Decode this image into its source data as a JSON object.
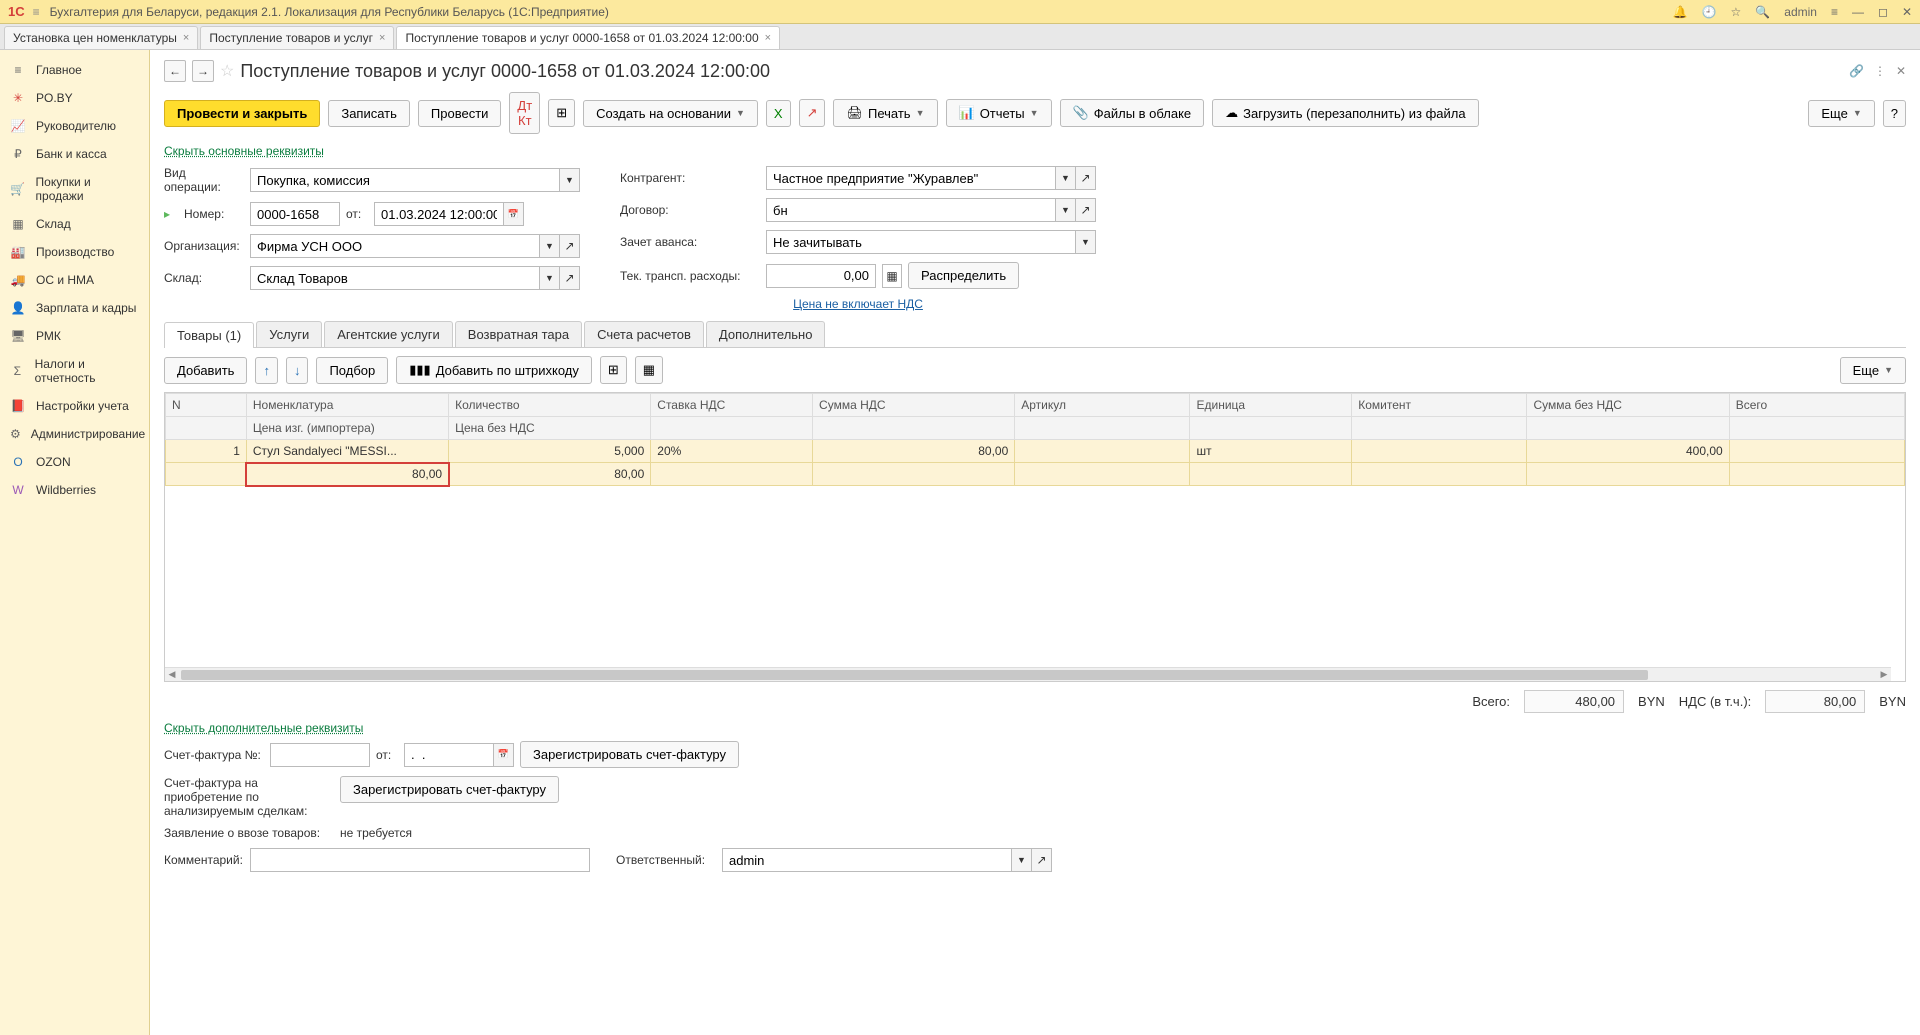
{
  "topbar": {
    "logo": "1C",
    "title": "Бухгалтерия для Беларуси, редакция 2.1. Локализация для Республики Беларусь   (1С:Предприятие)",
    "user": "admin"
  },
  "tabs": [
    {
      "label": "Установка цен номенклатуры",
      "active": false
    },
    {
      "label": "Поступление товаров и услуг",
      "active": false
    },
    {
      "label": "Поступление товаров и услуг 0000-1658 от 01.03.2024 12:00:00",
      "active": true
    }
  ],
  "sidebar": [
    {
      "icon": "≡",
      "label": "Главное",
      "cls": ""
    },
    {
      "icon": "✳",
      "label": "PO.BY",
      "cls": "red"
    },
    {
      "icon": "📈",
      "label": "Руководителю",
      "cls": ""
    },
    {
      "icon": "₽",
      "label": "Банк и касса",
      "cls": ""
    },
    {
      "icon": "🛒",
      "label": "Покупки и продажи",
      "cls": ""
    },
    {
      "icon": "▦",
      "label": "Склад",
      "cls": ""
    },
    {
      "icon": "🏭",
      "label": "Производство",
      "cls": ""
    },
    {
      "icon": "🚚",
      "label": "ОС и НМА",
      "cls": ""
    },
    {
      "icon": "👤",
      "label": "Зарплата и кадры",
      "cls": ""
    },
    {
      "icon": "🖥",
      "label": "РМК",
      "cls": ""
    },
    {
      "icon": "Σ",
      "label": "Налоги и отчетность",
      "cls": ""
    },
    {
      "icon": "📕",
      "label": "Настройки учета",
      "cls": ""
    },
    {
      "icon": "⚙",
      "label": "Администрирование",
      "cls": ""
    },
    {
      "icon": "O",
      "label": "OZON",
      "cls": "blue"
    },
    {
      "icon": "W",
      "label": "Wildberries",
      "cls": "purple"
    }
  ],
  "doc": {
    "title": "Поступление товаров и услуг 0000-1658 от 01.03.2024 12:00:00",
    "hide_main": "Скрыть основные реквизиты",
    "hide_extra": "Скрыть дополнительные реквизиты",
    "vat_link": "Цена не включает НДС"
  },
  "toolbar": {
    "post_close": "Провести и закрыть",
    "write": "Записать",
    "post": "Провести",
    "create_based": "Создать на основании",
    "print": "Печать",
    "reports": "Отчеты",
    "files": "Файлы в облаке",
    "load_file": "Загрузить (перезаполнить) из файла",
    "more": "Еще"
  },
  "fields": {
    "op_type_label": "Вид операции:",
    "op_type": "Покупка, комиссия",
    "number_label": "Номер:",
    "number": "0000-1658",
    "from_label": "от:",
    "date": "01.03.2024 12:00:00",
    "org_label": "Организация:",
    "org": "Фирма УСН ООО",
    "warehouse_label": "Склад:",
    "warehouse": "Склад Товаров",
    "counterparty_label": "Контрагент:",
    "counterparty": "Частное предприятие \"Журавлев\"",
    "contract_label": "Договор:",
    "contract": "бн",
    "advance_label": "Зачет аванса:",
    "advance": "Не зачитывать",
    "transport_label": "Тек. трансп. расходы:",
    "transport": "0,00",
    "distribute": "Распределить"
  },
  "subtabs": [
    {
      "label": "Товары (1)",
      "active": true
    },
    {
      "label": "Услуги",
      "active": false
    },
    {
      "label": "Агентские услуги",
      "active": false
    },
    {
      "label": "Возвратная тара",
      "active": false
    },
    {
      "label": "Счета расчетов",
      "active": false
    },
    {
      "label": "Дополнительно",
      "active": false
    }
  ],
  "table_toolbar": {
    "add": "Добавить",
    "pick": "Подбор",
    "barcode": "Добавить по штрихкоду",
    "more": "Еще"
  },
  "grid": {
    "headers_top": [
      "N",
      "Номенклатура",
      "Количество",
      "Ставка НДС",
      "Сумма НДС",
      "Артикул",
      "Единица",
      "Комитент",
      "Сумма без НДС",
      "Всего"
    ],
    "headers_bottom": [
      "",
      "Цена изг. (импортера)",
      "Цена без НДС",
      "",
      "",
      "",
      "",
      "",
      "",
      ""
    ],
    "row": {
      "n": "1",
      "nom": "Стул Sandalyeci \"MESSI...",
      "qty": "5,000",
      "vat_rate": "20%",
      "vat_sum": "80,00",
      "article": "",
      "unit": "шт",
      "komitent": "",
      "sum_novat": "400,00",
      "total": "",
      "price_izg": "80,00",
      "price_novat": "80,00"
    }
  },
  "totals": {
    "total_label": "Всего:",
    "total": "480,00",
    "currency": "BYN",
    "vat_label": "НДС (в т.ч.):",
    "vat": "80,00"
  },
  "invoice": {
    "sf_no_label": "Счет-фактура №:",
    "sf_from": "от:",
    "sf_date": ".  .",
    "register": "Зарегистрировать счет-фактуру",
    "sf_purchase_label": "Счет-фактура на приобретение по анализируемым сделкам:",
    "register2": "Зарегистрировать счет-фактуру",
    "import_label": "Заявление о ввозе товаров:",
    "import_val": "не требуется",
    "comment_label": "Комментарий:",
    "responsible_label": "Ответственный:",
    "responsible": "admin"
  }
}
